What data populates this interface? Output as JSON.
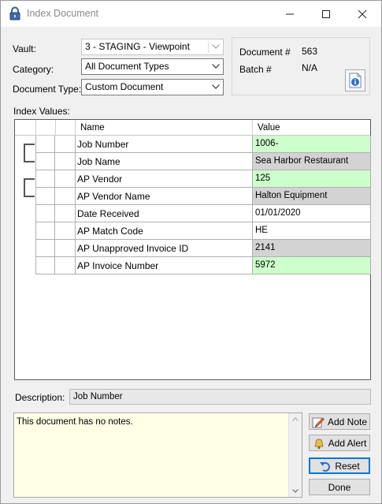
{
  "window": {
    "title": "Index Document"
  },
  "form": {
    "vault_label": "Vault:",
    "vault_value": "3 - STAGING - Viewpoint",
    "category_label": "Category:",
    "category_value": "All Document Types",
    "doctype_label": "Document Type:",
    "doctype_value": "Custom Document"
  },
  "docinfo": {
    "doc_label": "Document #",
    "doc_value": "563",
    "batch_label": "Batch #",
    "batch_value": "N/A"
  },
  "index": {
    "label": "Index Values:",
    "columns": [
      "Name",
      "Value"
    ],
    "rows": [
      {
        "name": "Job Number",
        "value": "1006-",
        "color": "#ccffcc"
      },
      {
        "name": "Job Name",
        "value": "Sea Harbor Restaurant",
        "color": "#d3d3d3"
      },
      {
        "name": "AP Vendor",
        "value": "125",
        "color": "#ccffcc"
      },
      {
        "name": "AP Vendor Name",
        "value": "Halton Equipment",
        "color": "#d3d3d3"
      },
      {
        "name": "Date Received",
        "value": "01/01/2020",
        "color": "#ffffff"
      },
      {
        "name": "AP Match Code",
        "value": "HE",
        "color": "#ffffff"
      },
      {
        "name": "AP Unapproved Invoice ID",
        "value": "2141",
        "color": "#d3d3d3"
      },
      {
        "name": "AP Invoice Number",
        "value": "5972",
        "color": "#ccffcc"
      }
    ]
  },
  "description": {
    "label": "Description:",
    "value": "Job Number"
  },
  "notes": {
    "text": "This document has no notes."
  },
  "buttons": {
    "add_note": "Add Note",
    "add_alert": "Add Alert",
    "reset": "Reset",
    "done": "Done"
  },
  "icons": {
    "title": "lock-icon",
    "info": "info-document-icon",
    "add_note": "pencil-note-icon",
    "add_alert": "bell-icon",
    "reset": "undo-icon"
  }
}
